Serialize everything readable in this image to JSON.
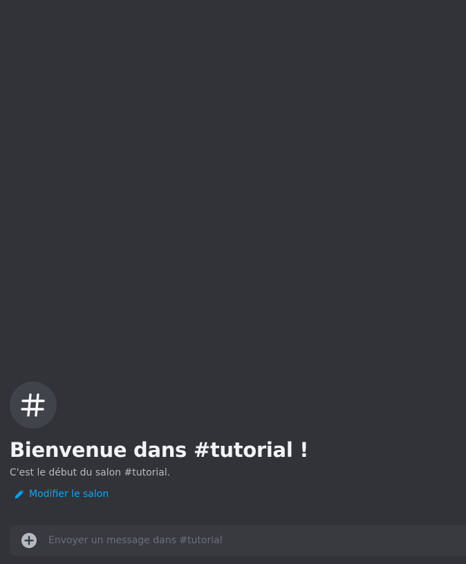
{
  "welcome": {
    "channel_icon": "hash-icon",
    "title": "Bienvenue dans #tutorial !",
    "subtitle": "C'est le début du salon #tutorial.",
    "edit_label": "Modifier le salon",
    "edit_icon": "pencil-icon"
  },
  "composer": {
    "placeholder": "Envoyer un message dans #tutorial",
    "value": "",
    "add_icon": "plus-circle-icon"
  },
  "colors": {
    "background": "#313338",
    "icon_circle": "#41434a",
    "title": "#f2f3f5",
    "subtitle": "#b5bac1",
    "link": "#00a8fc",
    "composer_bg": "#383a40",
    "placeholder": "#6d6f78"
  }
}
